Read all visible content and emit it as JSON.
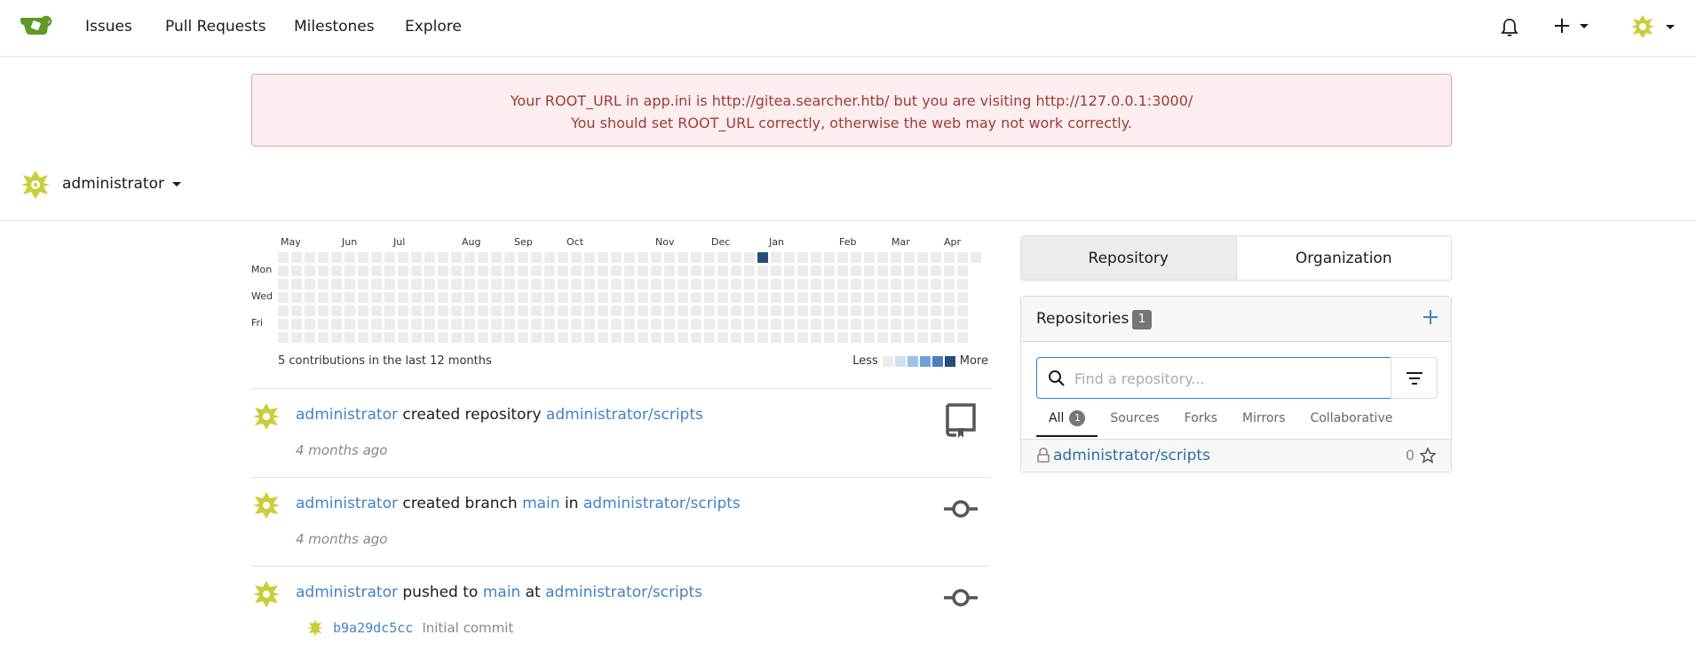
{
  "nav": {
    "items": [
      {
        "label": "Issues"
      },
      {
        "label": "Pull Requests"
      },
      {
        "label": "Milestones"
      },
      {
        "label": "Explore"
      }
    ]
  },
  "alert": {
    "line1": "Your ROOT_URL in app.ini is http://gitea.searcher.htb/ but you are visiting http://127.0.0.1:3000/",
    "line2": "You should set ROOT_URL correctly, otherwise the web may not work correctly."
  },
  "user": {
    "name": "administrator"
  },
  "heatmap": {
    "months": [
      "May",
      "Jun",
      "Jul",
      "Aug",
      "Sep",
      "Oct",
      "Nov",
      "Dec",
      "Jan",
      "Feb",
      "Mar",
      "Apr"
    ],
    "days": [
      "Mon",
      "Wed",
      "Fri"
    ],
    "total": "5 contributions in the last 12 months",
    "less": "Less",
    "more": "More",
    "colors": [
      "#ececec",
      "#cfe0f3",
      "#9dc1e8",
      "#6fa0d6",
      "#4a7fb8",
      "#274d7a"
    ]
  },
  "feed": {
    "items": [
      {
        "actor": "administrator",
        "verb": "created repository",
        "target": "administrator/scripts",
        "time": "4 months ago",
        "icon": "repo-icon"
      },
      {
        "actor": "administrator",
        "verb": "created branch",
        "branch": "main",
        "prep": "in",
        "target": "administrator/scripts",
        "time": "4 months ago",
        "icon": "commit-icon"
      },
      {
        "actor": "administrator",
        "verb": "pushed to",
        "branch": "main",
        "prep": "at",
        "target": "administrator/scripts",
        "sha": "b9a29dc5cc",
        "message": "Initial commit",
        "icon": "commit-icon"
      }
    ]
  },
  "sidebar": {
    "switcher": {
      "repository": "Repository",
      "organization": "Organization"
    },
    "repos": {
      "title": "Repositories",
      "count": "1",
      "search_placeholder": "Find a repository...",
      "tabs": [
        {
          "label": "All",
          "count": "1"
        },
        {
          "label": "Sources"
        },
        {
          "label": "Forks"
        },
        {
          "label": "Mirrors"
        },
        {
          "label": "Collaborative"
        }
      ],
      "list": [
        {
          "name": "administrator/scripts",
          "stars": "0"
        }
      ]
    }
  }
}
